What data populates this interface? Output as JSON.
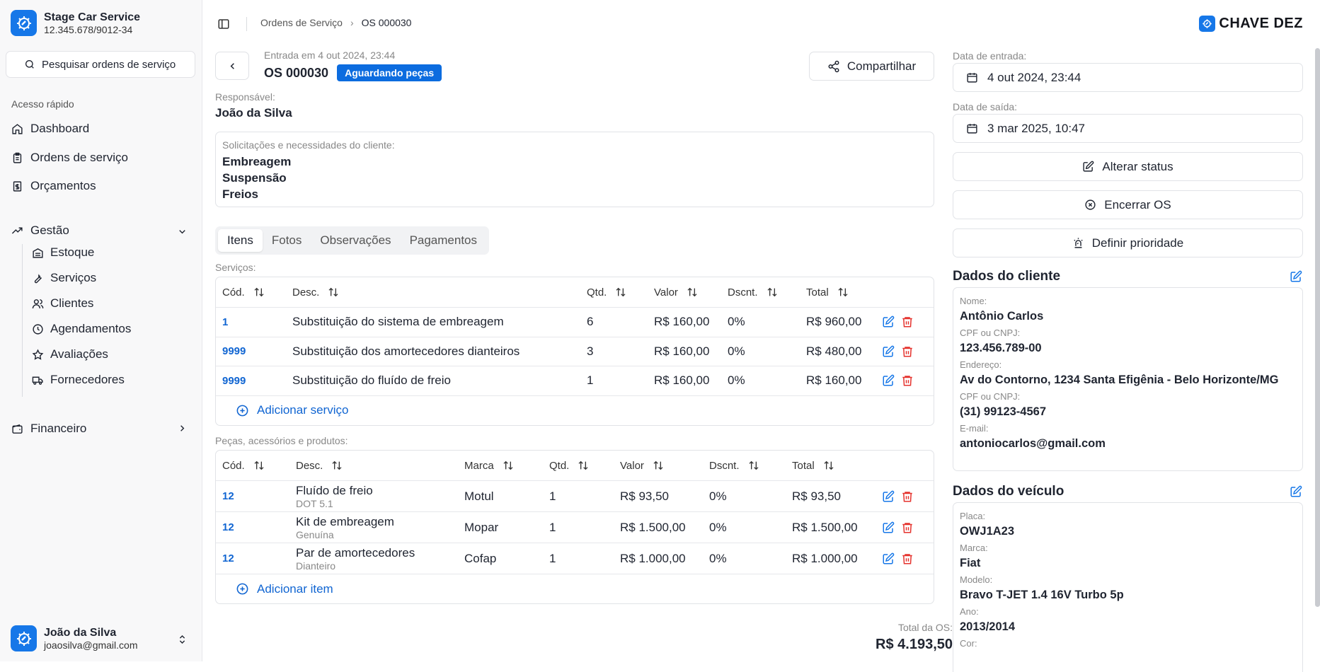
{
  "company": {
    "name": "Stage Car Service",
    "cnpj": "12.345.678/9012-34"
  },
  "sidebar": {
    "search_label": "Pesquisar ordens de serviço",
    "quick_access_label": "Acesso rápido",
    "items": [
      {
        "label": "Dashboard",
        "icon": "home-icon"
      },
      {
        "label": "Ordens de serviço",
        "icon": "clipboard-icon"
      },
      {
        "label": "Orçamentos",
        "icon": "receipt-icon"
      }
    ],
    "gestao": {
      "label": "Gestão",
      "icon": "trending-up-icon"
    },
    "gestao_items": [
      {
        "label": "Estoque",
        "icon": "warehouse-icon"
      },
      {
        "label": "Serviços",
        "icon": "wrench-icon"
      },
      {
        "label": "Clientes",
        "icon": "users-icon"
      },
      {
        "label": "Agendamentos",
        "icon": "clock-icon"
      },
      {
        "label": "Avaliações",
        "icon": "star-icon"
      },
      {
        "label": "Fornecedores",
        "icon": "truck-icon"
      }
    ],
    "financeiro": {
      "label": "Financeiro",
      "icon": "wallet-icon"
    }
  },
  "user": {
    "name": "João da Silva",
    "email": "joaosilva@gmail.com"
  },
  "breadcrumb": {
    "parent": "Ordens de Serviço",
    "current": "OS 000030"
  },
  "brand_logo_text": "CHAVE DEZ",
  "os": {
    "entry_text": "Entrada em 4 out 2024, 23:44",
    "number": "OS 000030",
    "status": "Aguardando peças",
    "share_label": "Compartilhar",
    "responsible_label": "Responsável:",
    "responsible": "João da Silva",
    "requests_label": "Solicitações e necessidades do cliente:",
    "requests": [
      "Embreagem",
      "Suspensão",
      "Freios"
    ]
  },
  "tabs": [
    {
      "label": "Itens",
      "active": true
    },
    {
      "label": "Fotos",
      "active": false
    },
    {
      "label": "Observações",
      "active": false
    },
    {
      "label": "Pagamentos",
      "active": false
    }
  ],
  "services": {
    "section_label": "Serviços:",
    "headers": {
      "code": "Cód.",
      "desc": "Desc.",
      "qty": "Qtd.",
      "value": "Valor",
      "discount": "Dscnt.",
      "total": "Total"
    },
    "rows": [
      {
        "code": "1",
        "desc": "Substituição do sistema de embreagem",
        "qty": "6",
        "value": "R$ 160,00",
        "discount": "0%",
        "total": "R$ 960,00"
      },
      {
        "code": "9999",
        "desc": "Substituição dos amortecedores dianteiros",
        "qty": "3",
        "value": "R$ 160,00",
        "discount": "0%",
        "total": "R$ 480,00"
      },
      {
        "code": "9999",
        "desc": "Substituição do fluído de freio",
        "qty": "1",
        "value": "R$ 160,00",
        "discount": "0%",
        "total": "R$ 160,00"
      }
    ],
    "add_label": "Adicionar serviço"
  },
  "parts": {
    "section_label": "Peças, acessórios e produtos:",
    "headers": {
      "code": "Cód.",
      "desc": "Desc.",
      "brand": "Marca",
      "qty": "Qtd.",
      "value": "Valor",
      "discount": "Dscnt.",
      "total": "Total"
    },
    "rows": [
      {
        "code": "12",
        "desc": "Fluído de freio",
        "sub": "DOT 5.1",
        "brand": "Motul",
        "qty": "1",
        "value": "R$ 93,50",
        "discount": "0%",
        "total": "R$ 93,50"
      },
      {
        "code": "12",
        "desc": "Kit de embreagem",
        "sub": "Genuína",
        "brand": "Mopar",
        "qty": "1",
        "value": "R$ 1.500,00",
        "discount": "0%",
        "total": "R$ 1.500,00"
      },
      {
        "code": "12",
        "desc": "Par de amortecedores",
        "sub": "Dianteiro",
        "brand": "Cofap",
        "qty": "1",
        "value": "R$ 1.000,00",
        "discount": "0%",
        "total": "R$ 1.000,00"
      }
    ],
    "add_label": "Adicionar item"
  },
  "total": {
    "label": "Total da OS:",
    "value": "R$ 4.193,50"
  },
  "right": {
    "entry_date_label": "Data de entrada:",
    "entry_date": "4 out 2024, 23:44",
    "exit_date_label": "Data de saída:",
    "exit_date": "3 mar 2025, 10:47",
    "change_status": "Alterar status",
    "close_os": "Encerrar OS",
    "set_priority": "Definir prioridade"
  },
  "client": {
    "title": "Dados do cliente",
    "fields": [
      {
        "label": "Nome:",
        "value": "Antônio Carlos"
      },
      {
        "label": "CPF ou CNPJ:",
        "value": "123.456.789-00"
      },
      {
        "label": "Endereço:",
        "value": "Av do Contorno, 1234 Santa Efigênia - Belo Horizonte/MG"
      },
      {
        "label": "CPF ou CNPJ:",
        "value": "(31) 99123-4567"
      },
      {
        "label": "E-mail:",
        "value": "antoniocarlos@gmail.com"
      }
    ]
  },
  "vehicle": {
    "title": "Dados do veículo",
    "fields": [
      {
        "label": "Placa:",
        "value": "OWJ1A23"
      },
      {
        "label": "Marca:",
        "value": "Fiat"
      },
      {
        "label": "Modelo:",
        "value": "Bravo T-JET 1.4 16V Turbo 5p"
      },
      {
        "label": "Ano:",
        "value": "2013/2014"
      },
      {
        "label": "Cor:",
        "value": ""
      }
    ]
  },
  "colors": {
    "accent": "#1677e8",
    "badge": "#0c6cdf",
    "link": "#1065d2",
    "danger": "#e5322d"
  }
}
